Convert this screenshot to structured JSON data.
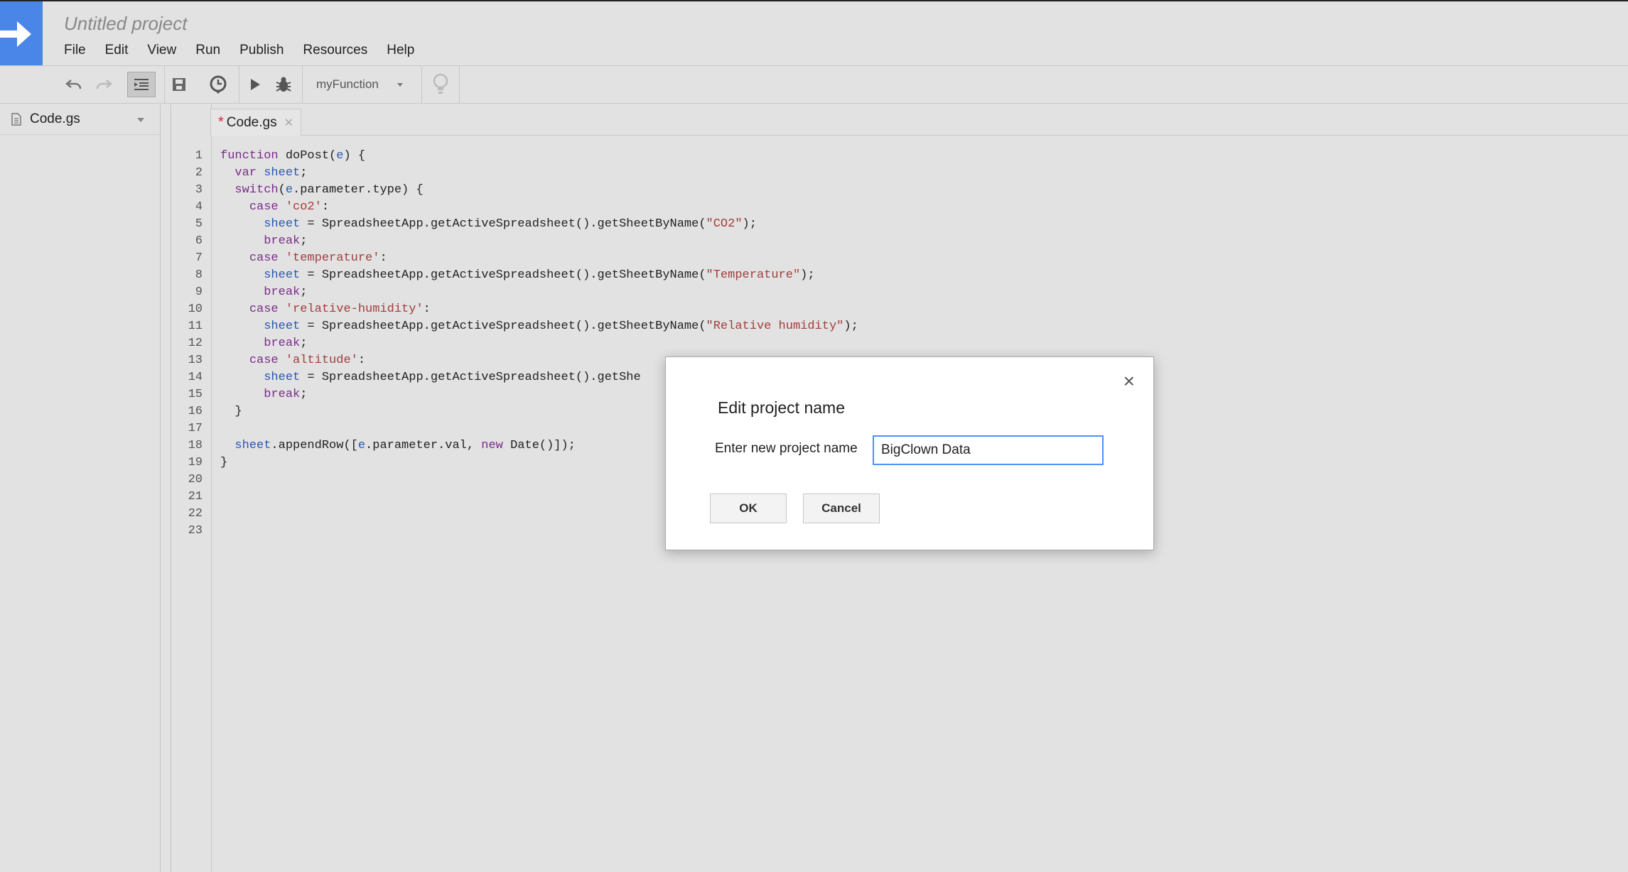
{
  "header": {
    "project_title": "Untitled project",
    "menu": [
      "File",
      "Edit",
      "View",
      "Run",
      "Publish",
      "Resources",
      "Help"
    ]
  },
  "toolbar": {
    "function_select": "myFunction"
  },
  "sidebar": {
    "file_name": "Code.gs"
  },
  "editor": {
    "tab_label": "Code.gs",
    "modified_marker": "*",
    "line_numbers": [
      "1",
      "2",
      "3",
      "4",
      "5",
      "6",
      "7",
      "8",
      "9",
      "10",
      "11",
      "12",
      "13",
      "14",
      "15",
      "16",
      "17",
      "18",
      "19",
      "20",
      "21",
      "22",
      "23"
    ]
  },
  "dialog": {
    "title": "Edit project name",
    "close": "×",
    "label": "Enter new project name",
    "input_value": "BigClown Data",
    "ok": "OK",
    "cancel": "Cancel"
  },
  "colors": {
    "accent": "#4a86e8",
    "keyword": "#7a2c8a",
    "variable": "#2a56b5",
    "string": "#a33c3c"
  },
  "icons": [
    "arrow-right-icon",
    "undo-icon",
    "redo-icon",
    "indent-icon",
    "save-icon",
    "clock-icon",
    "run-icon",
    "debug-icon",
    "lightbulb-icon",
    "document-icon",
    "close-icon"
  ]
}
